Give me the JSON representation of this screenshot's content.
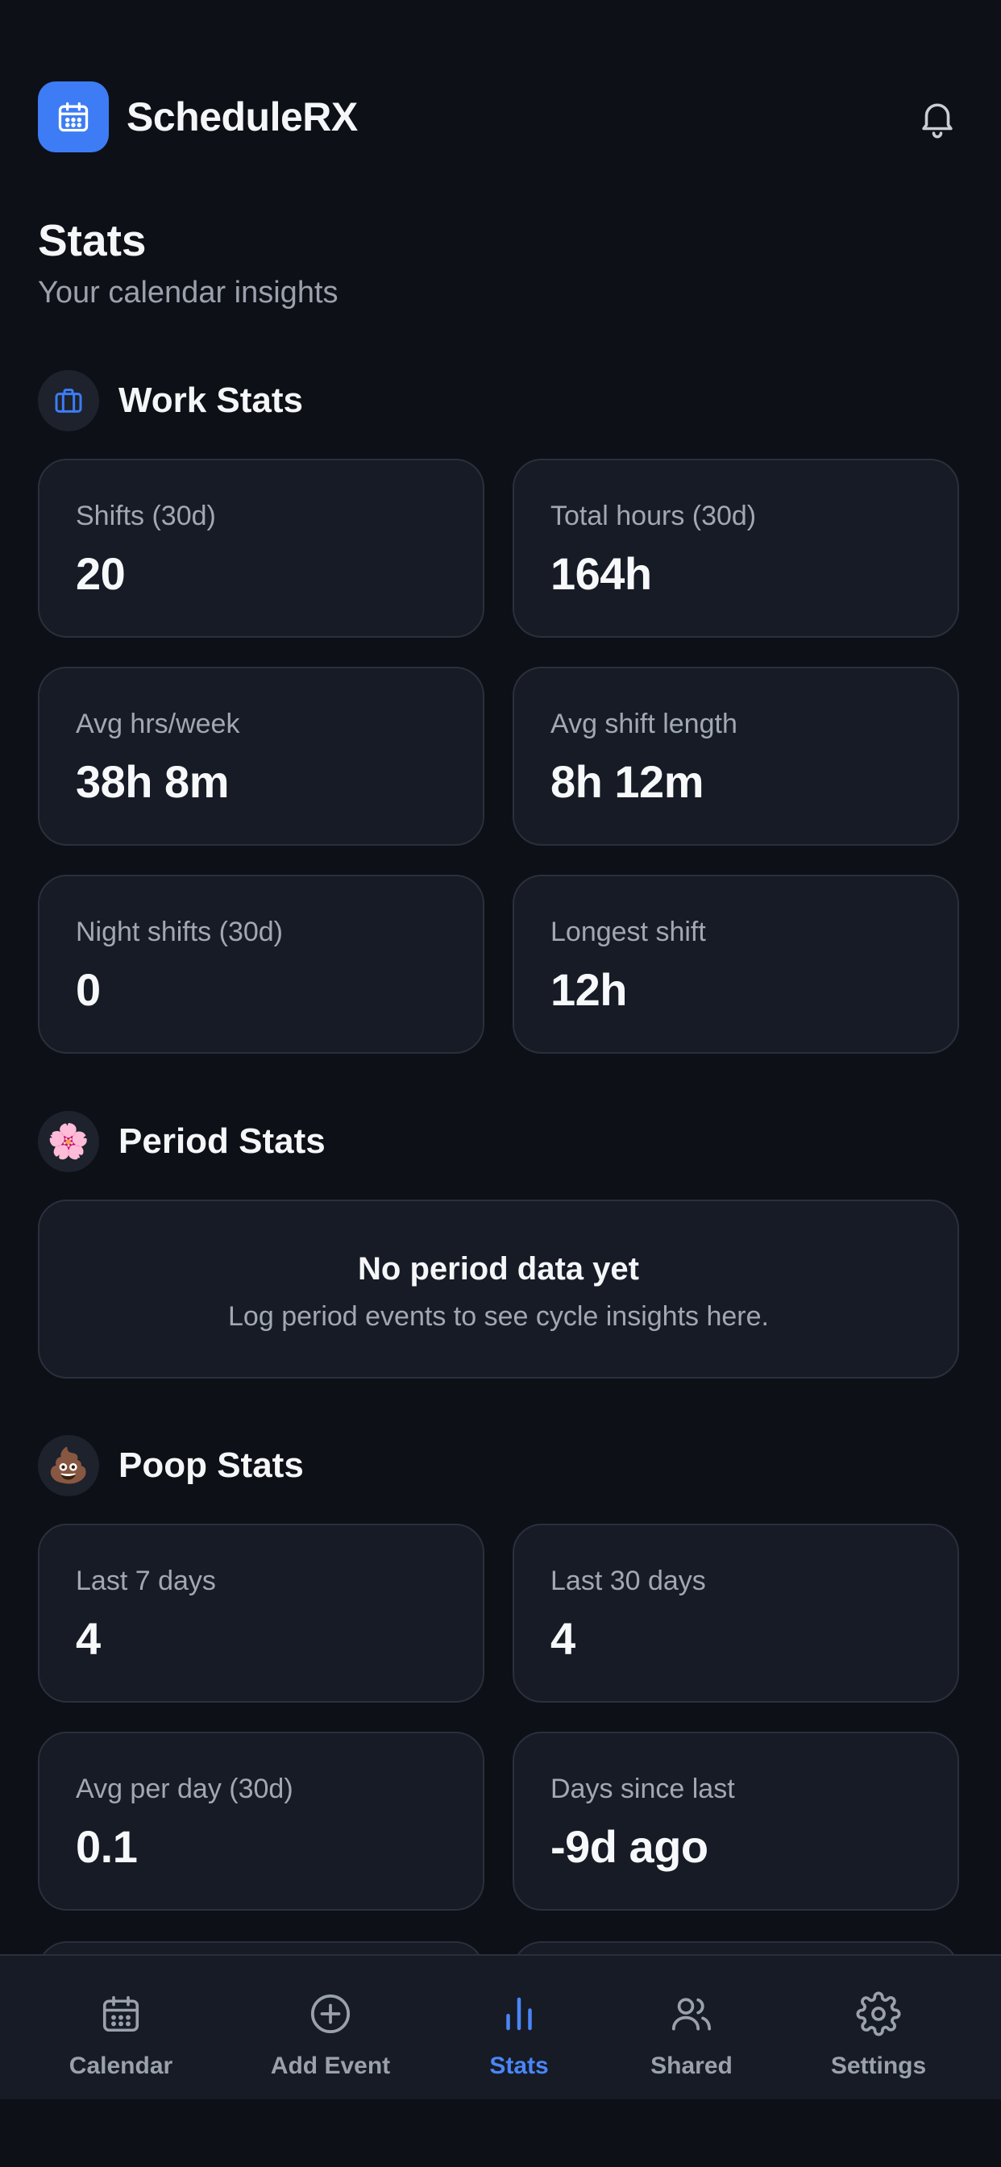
{
  "header": {
    "app_name": "ScheduleRX",
    "logo_icon": "calendar-icon",
    "notification_icon": "bell-icon",
    "accent_color": "#3d7cf5"
  },
  "page": {
    "title": "Stats",
    "subtitle": "Your calendar insights"
  },
  "work_stats": {
    "title": "Work Stats",
    "icon": "briefcase-icon",
    "cards": [
      {
        "label": "Shifts (30d)",
        "value": "20"
      },
      {
        "label": "Total hours (30d)",
        "value": "164h"
      },
      {
        "label": "Avg hrs/week",
        "value": "38h 8m"
      },
      {
        "label": "Avg shift length",
        "value": "8h 12m"
      },
      {
        "label": "Night shifts (30d)",
        "value": "0"
      },
      {
        "label": "Longest shift",
        "value": "12h"
      }
    ]
  },
  "period_stats": {
    "title": "Period Stats",
    "icon": "🌸",
    "empty_title": "No period data yet",
    "empty_text": "Log period events to see cycle insights here."
  },
  "poop_stats": {
    "title": "Poop Stats",
    "icon": "💩",
    "cards": [
      {
        "label": "Last 7 days",
        "value": "4"
      },
      {
        "label": "Last 30 days",
        "value": "4"
      },
      {
        "label": "Avg per day (30d)",
        "value": "0.1"
      },
      {
        "label": "Days since last",
        "value": "-9d ago"
      }
    ]
  },
  "nav": {
    "items": [
      {
        "label": "Calendar",
        "icon": "calendar-icon"
      },
      {
        "label": "Add Event",
        "icon": "plus-circle-icon"
      },
      {
        "label": "Stats",
        "icon": "bar-chart-icon",
        "active": true
      },
      {
        "label": "Shared",
        "icon": "users-icon"
      },
      {
        "label": "Settings",
        "icon": "gear-icon"
      }
    ],
    "active_color": "#4a86f7"
  }
}
